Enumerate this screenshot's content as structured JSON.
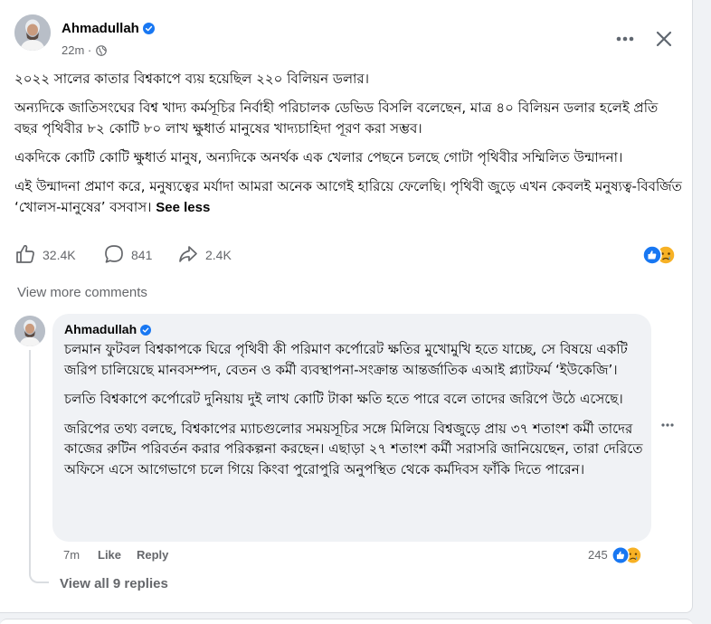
{
  "post": {
    "author": "Ahmadullah",
    "time": "22m",
    "paragraphs": [
      "২০২২ সালের কাতার বিশ্বকাপে ব্যয় হয়েছিল ২২০ বিলিয়ন ডলার।",
      "অন্যদিকে জাতিসংঘের বিশ্ব খাদ্য কর্মসূচির নির্বাহী পরিচালক ডেভিড বিসলি বলেছেন, মাত্র ৪০ বিলিয়ন ডলার হলেই প্রতি বছর পৃথিবীর ৮২ কোটি ৮০ লাখ ক্ষুধার্ত মানুষের খাদ্যচাহিদা পূরণ করা সম্ভব।",
      "একদিকে কোটি কোটি ক্ষুধার্ত মানুষ, অন্যদিকে অনর্থক এক খেলার পেছনে চলছে গোটা পৃথিবীর সম্মিলিত উন্মাদনা।",
      "এই উন্মাদনা প্রমাণ করে, মনুষ্যত্বের মর্যাদা আমরা অনেক আগেই হারিয়ে ফেলেছি। পৃথিবী জুড়ে এখন কেবলই মনুষ্যত্ব-বিবর্জিত ‘খোলস-মানুষের’ বসবাস।"
    ],
    "see_less": "See less",
    "likes": "32.4K",
    "comments": "841",
    "shares": "2.4K"
  },
  "view_more_comments": "View more comments",
  "comment": {
    "author": "Ahmadullah",
    "paragraphs": [
      "চলমান ফুটবল বিশ্বকাপকে ঘিরে পৃথিবী কী পরিমাণ কর্পোরেট ক্ষতির মুখোমুখি হতে যাচ্ছে, সে বিষয়ে একটি জরিপ চালিয়েছে মানবসম্পদ, বেতন ও কর্মী ব্যবস্থাপনা-সংক্রান্ত আন্তর্জাতিক এআই প্ল্যাটফর্ম ‘ইউকেজি’।",
      "চলতি বিশ্বকাপে কর্পোরেট দুনিয়ায় দুই লাখ কোটি টাকা ক্ষতি হতে পারে বলে তাদের জরিপে উঠে এসেছে।",
      "জরিপের তথ্য বলছে, বিশ্বকাপের ম্যাচগুলোর সময়সূচির সঙ্গে মিলিয়ে বিশ্বজুড়ে প্রায় ৩৭ শতাংশ কর্মী তাদের কাজের রুটিন পরিবর্তন করার পরিকল্পনা করছেন। এছাড়া ২৭ শতাংশ কর্মী সরাসরি জানিয়েছেন, তারা দেরিতে অফিসে এসে আগেভাগে চলে গিয়ে কিংবা পুরোপুরি অনুপস্থিত থেকে কর্মদিবস ফাঁকি দিতে পারেন।"
    ],
    "time": "7m",
    "like_label": "Like",
    "reply_label": "Reply",
    "reaction_count": "245",
    "view_replies": "View all 9 replies"
  },
  "colors": {
    "verified": "#1877f2",
    "like_blue": "#1877f2",
    "sad_yellow": "#f7b125",
    "secondary_text": "#65676b"
  },
  "icons": [
    "verified-badge-icon",
    "globe-icon",
    "more-options-icon",
    "close-icon",
    "like-icon",
    "comment-icon",
    "share-icon",
    "like-reaction-icon",
    "sad-reaction-icon"
  ]
}
